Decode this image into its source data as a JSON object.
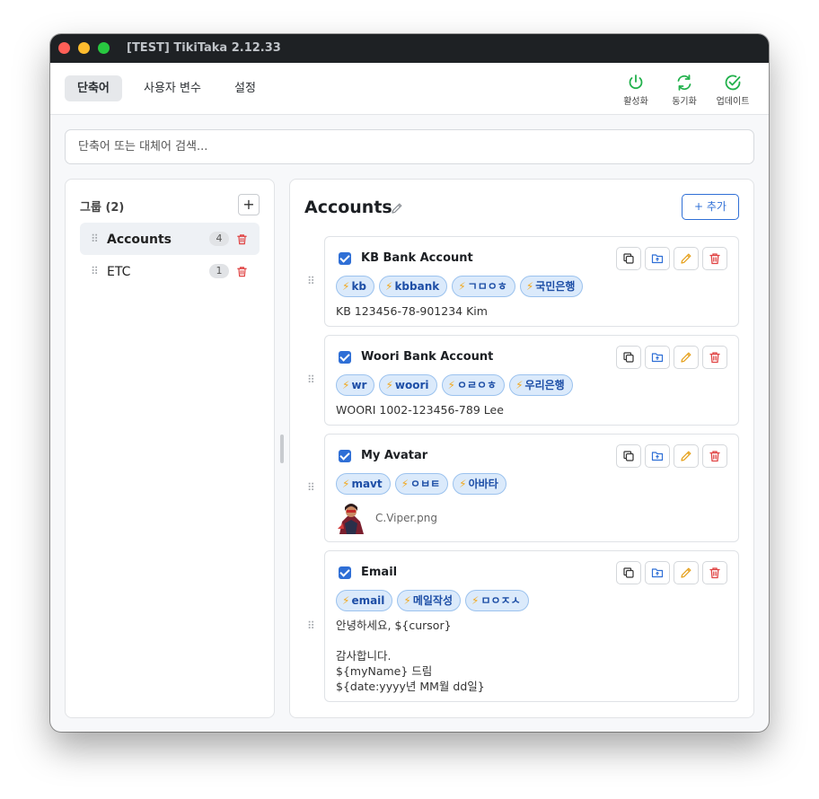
{
  "window": {
    "title": "[TEST] TikiTaka 2.12.33"
  },
  "tabs": [
    {
      "label": "단축어",
      "active": true
    },
    {
      "label": "사용자 변수",
      "active": false
    },
    {
      "label": "설정",
      "active": false
    }
  ],
  "tools": [
    {
      "label": "활성화",
      "icon": "power-icon",
      "color": "#22b14c"
    },
    {
      "label": "동기화",
      "icon": "sync-icon",
      "color": "#22b14c"
    },
    {
      "label": "업데이트",
      "icon": "check-circle-icon",
      "color": "#22b14c"
    }
  ],
  "search": {
    "placeholder": "단축어 또는 대체어 검색..."
  },
  "groups": {
    "header": "그룹 (2)",
    "add_label": "+",
    "items": [
      {
        "name": "Accounts",
        "count": "4",
        "active": true
      },
      {
        "name": "ETC",
        "count": "1",
        "active": false
      }
    ]
  },
  "panel": {
    "title": "Accounts",
    "add_label": "+ 추가"
  },
  "snippets": [
    {
      "name": "KB Bank Account",
      "checked": true,
      "tags": [
        "kb",
        "kbbank",
        "ㄱㅁㅇㅎ",
        "국민은행"
      ],
      "content": "KB 123456-78-901234 Kim"
    },
    {
      "name": "Woori Bank Account",
      "checked": true,
      "tags": [
        "wr",
        "woori",
        "ㅇㄹㅇㅎ",
        "우리은행"
      ],
      "content": "WOORI 1002-123456-789 Lee"
    },
    {
      "name": "My Avatar",
      "checked": true,
      "tags": [
        "mavt",
        "ㅇㅂㅌ",
        "아바타"
      ],
      "image_file": "C.Viper.png"
    },
    {
      "name": "Email",
      "checked": true,
      "tags": [
        "email",
        "메일작성",
        "ㅁㅇㅈㅅ"
      ],
      "content": "안녕하세요, ${cursor}\n\n감사합니다.\n${myName} 드림\n${date:yyyy년 MM월 dd일}"
    }
  ],
  "colors": {
    "accent": "#2f6fd6",
    "tag_bg": "#dbeafb",
    "tag_text": "#1d4ea6",
    "bolt": "#f2a81d",
    "delete": "#e04343",
    "edit": "#e6a21f"
  }
}
